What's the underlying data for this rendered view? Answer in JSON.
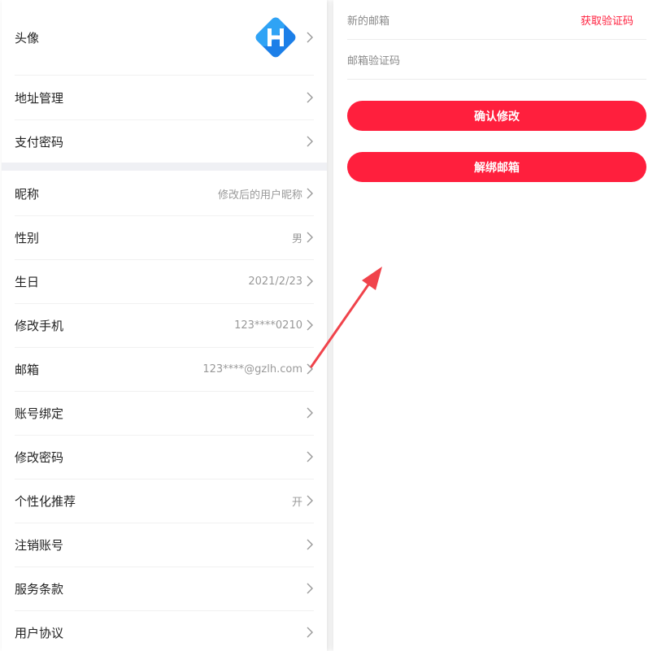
{
  "profile": {
    "avatar_label": "头像",
    "group1": [
      {
        "label": "地址管理",
        "value": ""
      },
      {
        "label": "支付密码",
        "value": ""
      }
    ],
    "group2": [
      {
        "label": "昵称",
        "value": "修改后的用户昵称"
      },
      {
        "label": "性别",
        "value": "男"
      },
      {
        "label": "生日",
        "value": "2021/2/23"
      },
      {
        "label": "修改手机",
        "value": "123****0210"
      },
      {
        "label": "邮箱",
        "value": "123****@gzlh.com"
      },
      {
        "label": "账号绑定",
        "value": ""
      },
      {
        "label": "修改密码",
        "value": ""
      },
      {
        "label": "个性化推荐",
        "value": "开"
      },
      {
        "label": "注销账号",
        "value": ""
      },
      {
        "label": "服务条款",
        "value": ""
      },
      {
        "label": "用户协议",
        "value": ""
      }
    ]
  },
  "email_form": {
    "new_email_placeholder": "新的邮箱",
    "get_code_label": "获取验证码",
    "code_placeholder": "邮箱验证码",
    "confirm_label": "确认修改",
    "unbind_label": "解绑邮箱"
  },
  "colors": {
    "accent": "#ff1f3d",
    "annotation_arrow": "#f0434b",
    "avatar_blue": "#1c7fe8"
  },
  "icons": {
    "chevron": "chevron-right-icon",
    "avatar": "app-logo-icon"
  }
}
